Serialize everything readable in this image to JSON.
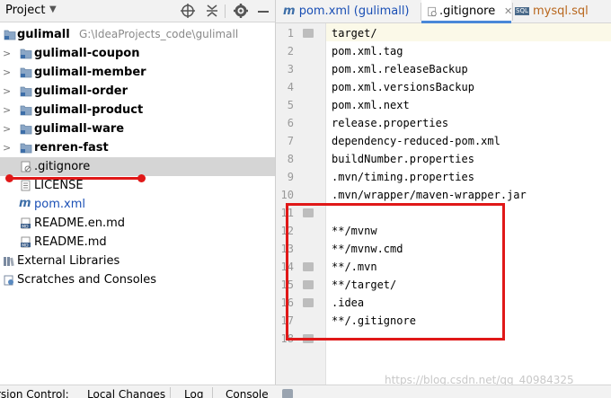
{
  "project_panel": {
    "title": "Project",
    "icons": [
      "crosshair-icon",
      "collapse-icon",
      "gear-icon",
      "minimize-icon"
    ]
  },
  "tree": {
    "root": {
      "name": "gulimall",
      "path": "G:\\IdeaProjects_code\\gulimall"
    },
    "modules": [
      "gulimall-coupon",
      "gulimall-member",
      "gulimall-order",
      "gulimall-product",
      "gulimall-ware",
      "renren-fast"
    ],
    "files": [
      ".gitignore",
      "LICENSE",
      "pom.xml",
      "README.en.md",
      "README.md"
    ],
    "external_libraries": "External Libraries",
    "scratches": "Scratches and Consoles"
  },
  "editor": {
    "tabs": [
      {
        "label": "pom.xml (gulimall)",
        "icon": "maven-icon"
      },
      {
        "label": ".gitignore",
        "icon": "gitignore-icon"
      },
      {
        "label": "mysql.sql",
        "icon": "sql-icon"
      }
    ],
    "active_tab": ".gitignore",
    "line_numbers": [
      "1",
      "2",
      "3",
      "4",
      "5",
      "6",
      "7",
      "8",
      "9",
      "10",
      "11",
      "12",
      "13",
      "14",
      "15",
      "16",
      "17",
      "18"
    ],
    "lines": [
      "target/",
      "pom.xml.tag",
      "pom.xml.releaseBackup",
      "pom.xml.versionsBackup",
      "pom.xml.next",
      "release.properties",
      "dependency-reduced-pom.xml",
      "buildNumber.properties",
      ".mvn/timing.properties",
      ".mvn/wrapper/maven-wrapper.jar",
      "",
      "**/mvnw",
      "**/mvnw.cmd",
      "**/.mvn",
      "**/target/",
      ".idea",
      "**/.gitignore",
      ""
    ]
  },
  "bottom_bar": {
    "tabs": [
      "rsion Control:",
      "Local Changes",
      "Log",
      "Console"
    ]
  },
  "watermark": "https://blog.csdn.net/qq_40984325",
  "colors": {
    "annotation_red": "#e01818",
    "selection": "#d5d5d5",
    "tab_underline": "#4a88d8"
  }
}
